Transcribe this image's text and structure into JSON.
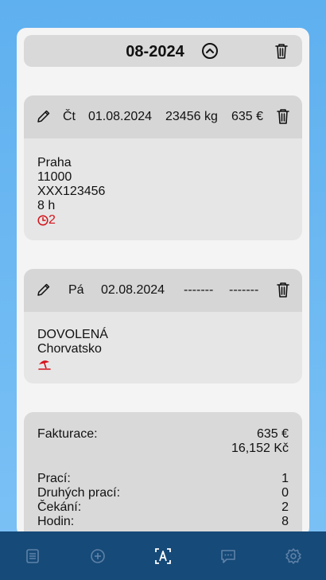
{
  "month": {
    "title": "08-2024"
  },
  "entries": [
    {
      "day": "Čt",
      "date": "01.08.2024",
      "weight": "23456 kg",
      "price": "635 €",
      "lines": [
        "Praha",
        "11000",
        "XXX123456",
        "8 h"
      ],
      "waiting": "2"
    },
    {
      "day": "Pá",
      "date": "02.08.2024",
      "weight": "-------",
      "price": "-------",
      "lines": [
        "DOVOLENÁ",
        "Chorvatsko"
      ]
    }
  ],
  "summary": {
    "billing_label": "Fakturace:",
    "billing_eur": "635 €",
    "billing_czk": "16,152 Kč",
    "rows": [
      {
        "label": "Prací:",
        "value": "1"
      },
      {
        "label": "Druhých prací:",
        "value": "0"
      },
      {
        "label": "Čekání:",
        "value": "2"
      },
      {
        "label": "Hodin:",
        "value": "8"
      }
    ]
  },
  "nav": {
    "items": [
      "list",
      "add",
      "scan",
      "messages",
      "settings"
    ],
    "active": "scan"
  },
  "colors": {
    "accent_red": "#d4121a",
    "nav_bg": "#164a78",
    "nav_active": "#ffffff",
    "nav_inactive": "#5f82a8"
  }
}
